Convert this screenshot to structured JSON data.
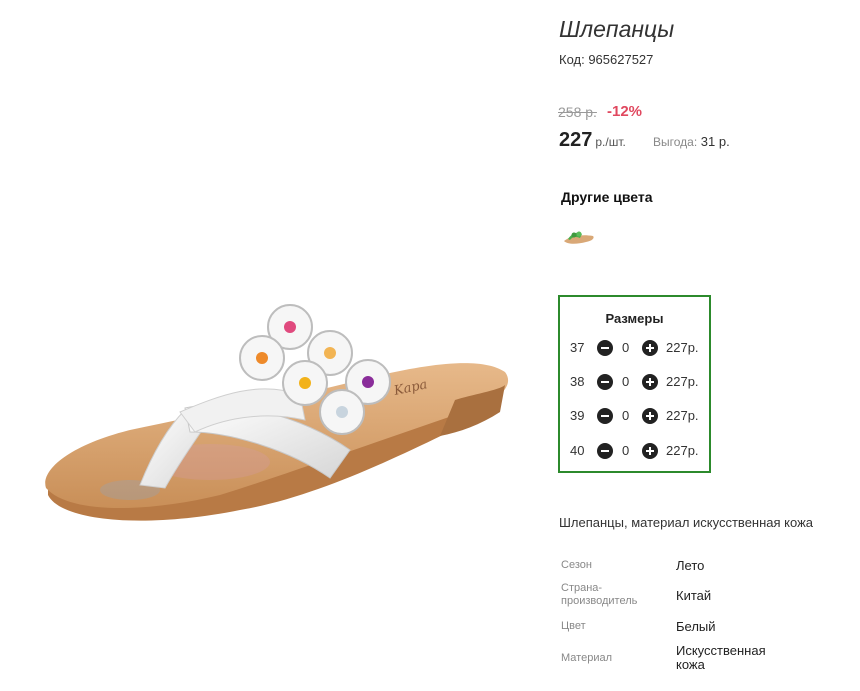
{
  "product": {
    "title": "Шлепанцы",
    "code": "Код: 965627527",
    "old_price": "258 р.",
    "discount": "-12%",
    "price": "227",
    "price_unit": "р./шт.",
    "benefit_label": "Выгода:",
    "benefit_value": "31 р.",
    "image_icon": "sandal-photo"
  },
  "other_colors": {
    "title": "Другие цвета",
    "thumb_icon": "green-sandal-thumbnail"
  },
  "sizes": {
    "title": "Размеры",
    "rows": [
      {
        "size": "37",
        "qty": "0",
        "price": "227р."
      },
      {
        "size": "38",
        "qty": "0",
        "price": "227р."
      },
      {
        "size": "39",
        "qty": "0",
        "price": "227р."
      },
      {
        "size": "40",
        "qty": "0",
        "price": "227р."
      }
    ],
    "border_color": "#2c8a2c"
  },
  "description": "Шлепанцы, материал искусственная кожа",
  "attributes": [
    {
      "label": "Сезон",
      "value": "Лето"
    },
    {
      "label": "Страна-производитель",
      "value": "Китай"
    },
    {
      "label": "Цвет",
      "value": "Белый"
    },
    {
      "label": "Материал",
      "value": "Искусственная кожа"
    }
  ],
  "colors": {
    "discount": "#e0485f",
    "accent_border": "#2c8a2c"
  }
}
